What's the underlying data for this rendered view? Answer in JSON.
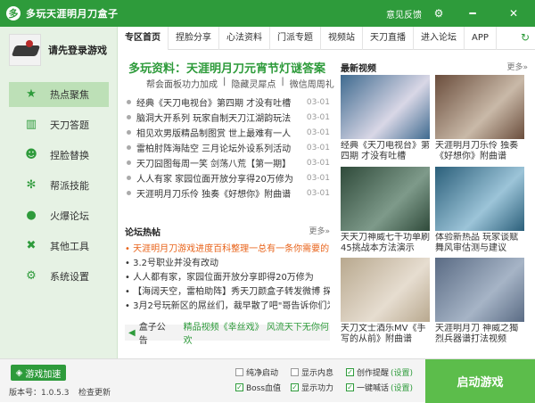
{
  "window": {
    "title": "多玩天涯明月刀盒子",
    "feedback": "意见反馈",
    "settings_icon": "gear",
    "minimize_icon": "minus",
    "close_icon": "x"
  },
  "sidebar": {
    "login_text": "请先登录游戏",
    "items": [
      {
        "label": "热点聚焦",
        "icon": "star"
      },
      {
        "label": "天刀答题",
        "icon": "book"
      },
      {
        "label": "捏脸替换",
        "icon": "mask"
      },
      {
        "label": "帮派技能",
        "icon": "swirl"
      },
      {
        "label": "火爆论坛",
        "icon": "chat"
      },
      {
        "label": "其他工具",
        "icon": "tools"
      },
      {
        "label": "系统设置",
        "icon": "gear"
      }
    ]
  },
  "tabs": [
    "专区首页",
    "捏脸分享",
    "心法资料",
    "门派专题",
    "视频站",
    "天刀直播",
    "进入论坛",
    "APP"
  ],
  "headline": "多玩资料：天涯明月刀元宵节灯谜答案",
  "subline": [
    "帮会面板功力加成",
    "隐藏灵犀点",
    "微信周周礼"
  ],
  "news": [
    {
      "title": "经典《天刀电视台》第四期 才没有吐槽",
      "date": "03-01"
    },
    {
      "title": "脑洞大开系列 玩家自制天刀江湖韵玩法",
      "date": "03-01"
    },
    {
      "title": "相见欢男版精品制图赏 世上最难有一人",
      "date": "03-01"
    },
    {
      "title": "雷柏肘阵海陆空 三月论坛外设系列活动",
      "date": "03-01"
    },
    {
      "title": "天刀囧图每周一笑 剑荡八荒【第一期】",
      "date": "03-01"
    },
    {
      "title": "人人有家 家园位面开放分享得20万修为",
      "date": "03-01"
    },
    {
      "title": "天涯明月刀乐伶 独奏《好想你》附曲谱",
      "date": "03-01"
    }
  ],
  "forum": {
    "title": "论坛热帖",
    "more": "更多»",
    "posts": [
      "天涯明月刀游戏进度百科整理一总有一条你需要的",
      "3.2号职业并没有改动",
      "人人都有家，家园位面开放分享即得20万修为",
      "【海阔天空，雷柏助阵】秀天刀颜盒子转发微博 探悉霸",
      "3月2号玩新区的屌丝们，裁早散了吧\"哥告诉你们为啥。"
    ]
  },
  "notice": {
    "label": "盒子公告",
    "text": "精品视频《幸丝戏》 风流天下无你何欢"
  },
  "videos": {
    "title": "最新视频",
    "more": "更多»",
    "items": [
      {
        "title": "经典《天刀电视台》第四期 才没有吐槽",
        "c1": "#3e6a8f",
        "c2": "#d9d7e6"
      },
      {
        "title": "天涯明月刀乐伶 独奏《好想你》附曲谱",
        "c1": "#6a4d3c",
        "c2": "#c9b9a8"
      },
      {
        "title": "天天刀神威七千功单刷45挑战本方法演示",
        "c1": "#2f4a3a",
        "c2": "#7e9a8a"
      },
      {
        "title": "体验新热品 玩家谈赋舞风审估测与建议",
        "c1": "#2b5f7a",
        "c2": "#9cc4d8"
      },
      {
        "title": "天刀文士酒乐MV《手写的从前》附曲谱",
        "c1": "#b8a88e",
        "c2": "#e6ddd0"
      },
      {
        "title": "天涯明月刀 神威之獨烈兵器谱打法视频",
        "c1": "#5a6b84",
        "c2": "#a6b4c6"
      }
    ]
  },
  "bottom": {
    "speed_button": "游戏加速",
    "version": "版本号：1.0.5.3",
    "check_update": "检查更新",
    "options": [
      {
        "label": "纯净启动",
        "checked": false
      },
      {
        "label": "显示内息",
        "checked": false
      },
      {
        "label": "创作提醒",
        "checked": true,
        "extra": "(设置)"
      },
      {
        "label": "Boss血值",
        "checked": true
      },
      {
        "label": "显示功力",
        "checked": true
      },
      {
        "label": "一键喊话",
        "checked": true,
        "extra": "(设置)"
      }
    ],
    "launch": "启动游戏"
  }
}
